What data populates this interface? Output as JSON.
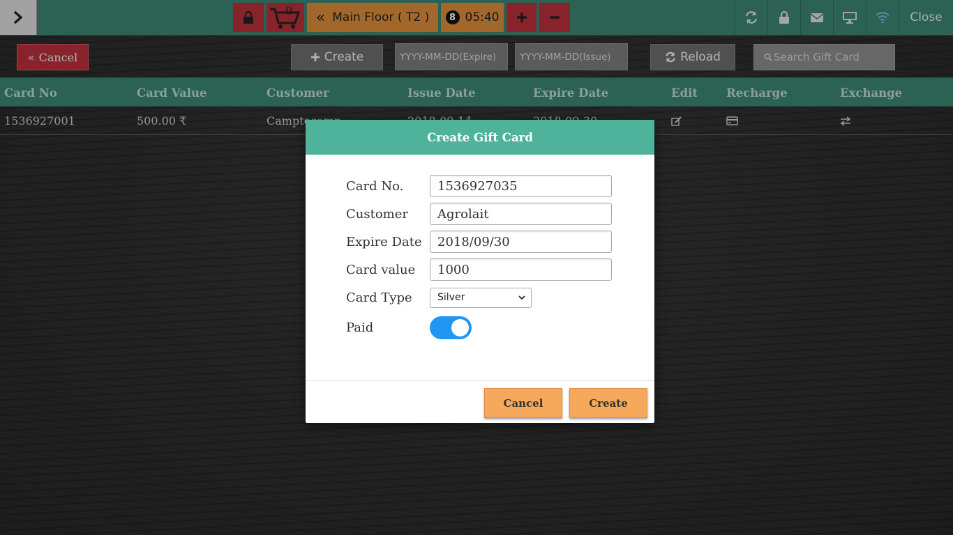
{
  "topbar": {
    "cart_count": "0",
    "floor_label": "Main Floor ( T2 )",
    "badge_number": "8",
    "timer": "05:40",
    "close_label": "Close"
  },
  "toolbar": {
    "cancel_label": "Cancel",
    "create_label": "Create",
    "expire_placeholder": "YYYY-MM-DD(Expire)",
    "issue_placeholder": "YYYY-MM-DD(Issue)",
    "reload_label": "Reload",
    "search_placeholder": "Search Gift Card"
  },
  "table": {
    "headers": [
      "Card No",
      "Card Value",
      "Customer",
      "Issue Date",
      "Expire Date",
      "Edit",
      "Recharge",
      "Exchange"
    ],
    "rows": [
      {
        "card_no": "1536927001",
        "card_value": "500.00 ₹",
        "customer": "Camptocamp",
        "issue_date": "2018-09-14",
        "expire_date": "2018-09-30"
      }
    ]
  },
  "modal": {
    "title": "Create Gift Card",
    "fields": {
      "card_no_label": "Card No.",
      "card_no_value": "1536927035",
      "customer_label": "Customer",
      "customer_value": "Agrolait",
      "expire_label": "Expire Date",
      "expire_value": "2018/09/30",
      "card_value_label": "Card value",
      "card_value_value": "1000",
      "card_type_label": "Card Type",
      "card_type_value": "Silver",
      "paid_label": "Paid"
    },
    "cancel_label": "Cancel",
    "create_label": "Create"
  },
  "colors": {
    "topbar": "#3a8370",
    "accent_red": "#b72f3a",
    "accent_orange": "#d98a3a",
    "modal_header": "#4fb39b",
    "modal_button": "#f6a95a",
    "toggle_on": "#2196f3"
  }
}
